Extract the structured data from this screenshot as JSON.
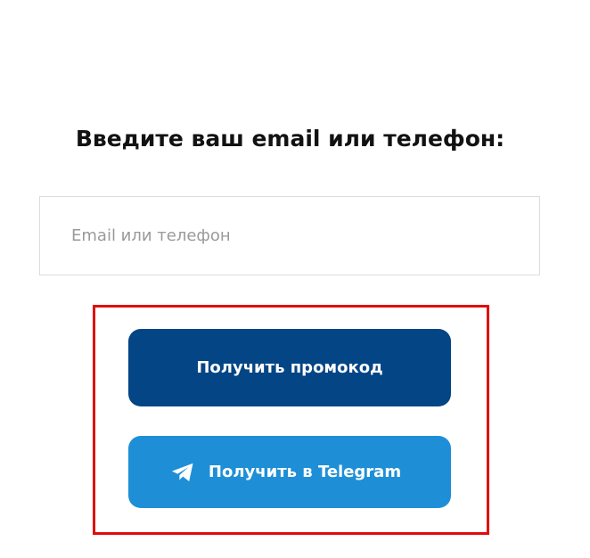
{
  "form": {
    "title": "Введите ваш email или телефон:",
    "contact_input": {
      "placeholder": "Email или телефон",
      "value": ""
    },
    "promo_button_label": "Получить промокод",
    "telegram_button": {
      "label": "Получить в Telegram",
      "icon": "telegram-plane-icon"
    }
  },
  "colors": {
    "promo_button": "#044585",
    "telegram_button": "#1e8fd6",
    "highlight_border": "#e10b0b",
    "title_text": "#121212"
  }
}
